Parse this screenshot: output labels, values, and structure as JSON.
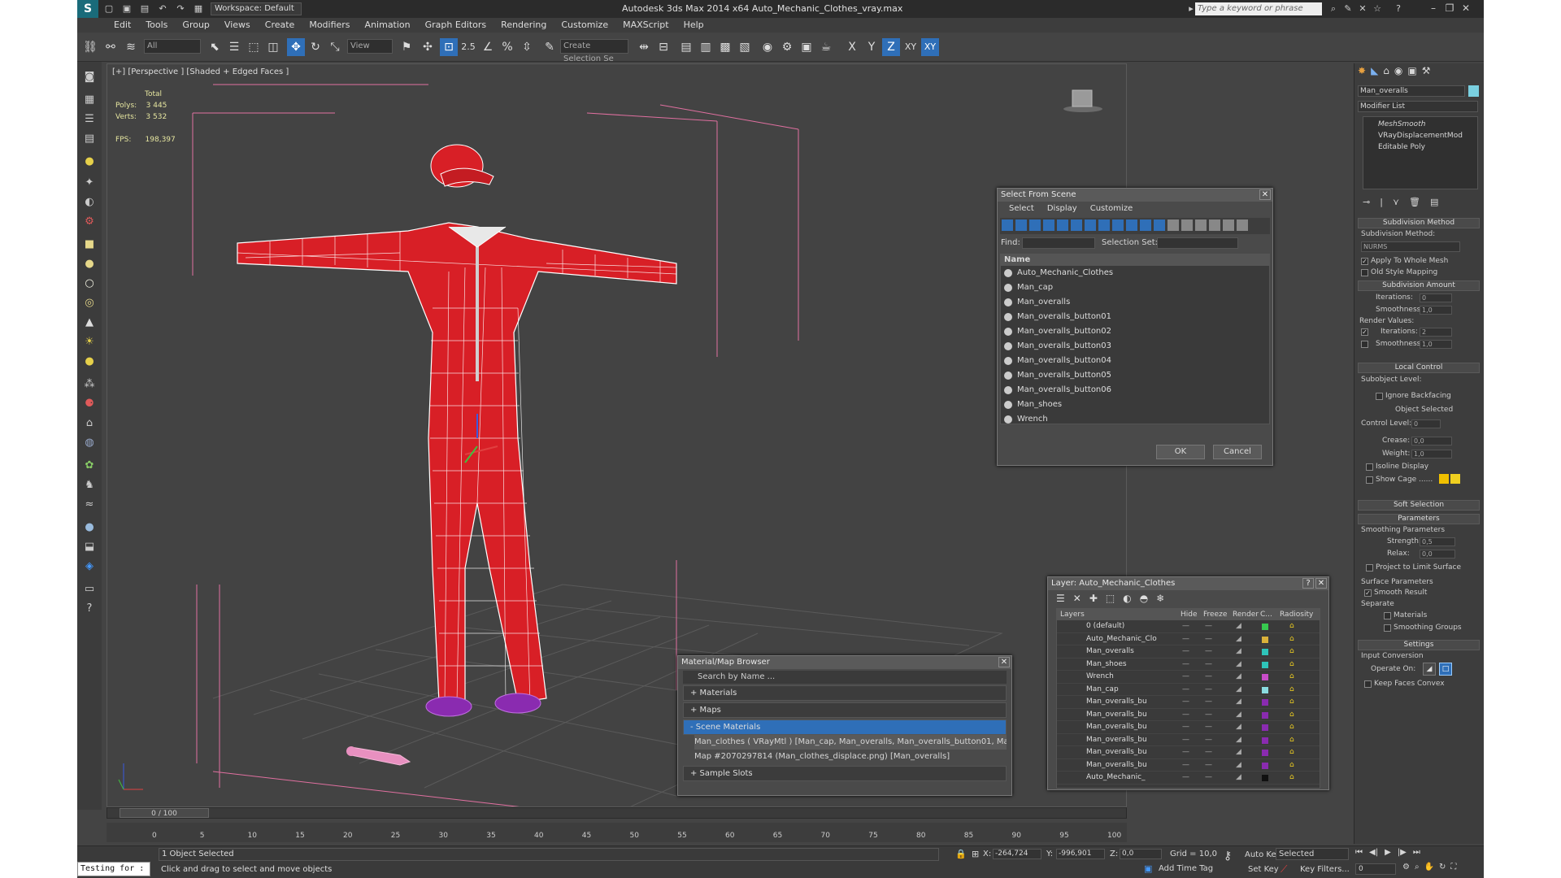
{
  "title": {
    "workspace": "Workspace: Default",
    "app_title": "Autodesk 3ds Max  2014 x64     Auto_Mechanic_Clothes_vray.max",
    "search_placeholder": "Type a keyword or phrase"
  },
  "menu": [
    "Edit",
    "Tools",
    "Group",
    "Views",
    "Create",
    "Modifiers",
    "Animation",
    "Graph Editors",
    "Rendering",
    "Customize",
    "MAXScript",
    "Help"
  ],
  "toolbar": {
    "filter": "All",
    "ref_coord": "View",
    "selection_set": "Create Selection Se",
    "snap_label": "2.5",
    "coord_labels": [
      "X",
      "Y",
      "Z",
      "XY",
      "XY"
    ]
  },
  "viewport": {
    "label": "[+] [Perspective ] [Shaded + Edged Faces ]",
    "stats_total": "Total",
    "polys_label": "Polys:",
    "polys": "3 445",
    "verts_label": "Verts:",
    "verts": "3 532",
    "fps_label": "FPS:",
    "fps": "198,397"
  },
  "select_from_scene": {
    "title": "Select From Scene",
    "menus": [
      "Select",
      "Display",
      "Customize"
    ],
    "find_label": "Find:",
    "selection_set_label": "Selection Set:",
    "column": "Name",
    "items": [
      "Auto_Mechanic_Clothes",
      "Man_cap",
      "Man_overalls",
      "Man_overalls_button01",
      "Man_overalls_button02",
      "Man_overalls_button03",
      "Man_overalls_button04",
      "Man_overalls_button05",
      "Man_overalls_button06",
      "Man_shoes",
      "Wrench"
    ],
    "ok": "OK",
    "cancel": "Cancel"
  },
  "material_browser": {
    "title": "Material/Map Browser",
    "search_placeholder": "Search by Name ...",
    "groups": [
      "+ Materials",
      "+ Maps",
      "- Scene Materials"
    ],
    "entries": [
      "Man_clothes  ( VRayMtl )  [Man_cap, Man_overalls, Man_overalls_button01, Man_o...",
      "Map #2070297814 (Man_clothes_displace.png) [Man_overalls]"
    ],
    "sample_slots": "+ Sample Slots"
  },
  "layer_manager": {
    "title": "Layer: Auto_Mechanic_Clothes",
    "columns": [
      "Layers",
      "Hide",
      "Freeze",
      "Render",
      "C...",
      "Radiosity"
    ],
    "rows": [
      {
        "name": "0 (default)",
        "color": "#37c94f"
      },
      {
        "name": "Auto_Mechanic_Clo",
        "color": "#d9b13a"
      },
      {
        "name": "Man_overalls",
        "color": "#2ec4b9"
      },
      {
        "name": "Man_shoes",
        "color": "#2ec4b9"
      },
      {
        "name": "Wrench",
        "color": "#c84cc8"
      },
      {
        "name": "Man_cap",
        "color": "#8adbe0"
      },
      {
        "name": "Man_overalls_bu",
        "color": "#8a2bb0"
      },
      {
        "name": "Man_overalls_bu",
        "color": "#8a2bb0"
      },
      {
        "name": "Man_overalls_bu",
        "color": "#8a2bb0"
      },
      {
        "name": "Man_overalls_bu",
        "color": "#8a2bb0"
      },
      {
        "name": "Man_overalls_bu",
        "color": "#8a2bb0"
      },
      {
        "name": "Man_overalls_bu",
        "color": "#8a2bb0"
      },
      {
        "name": "Auto_Mechanic_",
        "color": "#111111"
      }
    ]
  },
  "command_panel": {
    "object_name": "Man_overalls",
    "modifier_list": "Modifier List",
    "stack": [
      "MeshSmooth",
      "VRayDisplacementMod",
      "Editable Poly"
    ],
    "subdivision_method_title": "Subdivision Method",
    "subdivision_method_label": "Subdivision Method:",
    "subdivision_method_value": "NURMS",
    "apply_whole_mesh": "Apply To Whole Mesh",
    "old_style_mapping": "Old Style Mapping",
    "subdivision_amount_title": "Subdivision Amount",
    "iterations_label": "Iterations:",
    "iterations": "0",
    "smoothness_label": "Smoothness:",
    "smoothness": "1,0",
    "render_values": "Render Values:",
    "render_iterations": "2",
    "render_smoothness": "1,0",
    "local_control_title": "Local Control",
    "subobject_level": "Subobject Level:",
    "ignore_backfacing": "Ignore Backfacing",
    "object_selected": "Object Selected",
    "control_level_label": "Control Level:",
    "control_level": "0",
    "crease_label": "Crease:",
    "crease": "0,0",
    "weight_label": "Weight:",
    "weight": "1,0",
    "isoline_display": "Isoline Display",
    "show_cage": "Show Cage ......",
    "soft_selection": "Soft Selection",
    "parameters": "Parameters",
    "smoothing_parameters": "Smoothing Parameters",
    "strength_label": "Strength:",
    "strength": "0,5",
    "relax_label": "Relax:",
    "relax": "0,0",
    "project_limit": "Project to Limit Surface",
    "surface_parameters": "Surface Parameters",
    "smooth_result": "Smooth Result",
    "separate": "Separate",
    "materials": "Materials",
    "smoothing_groups": "Smoothing Groups",
    "settings": "Settings",
    "input_conversion": "Input Conversion",
    "operate_on": "Operate On:",
    "keep_faces_convex": "Keep Faces Convex"
  },
  "timeline": {
    "slider": "0 / 100",
    "ticks": [
      "0",
      "5",
      "10",
      "15",
      "20",
      "25",
      "30",
      "35",
      "40",
      "45",
      "50",
      "55",
      "60",
      "65",
      "70",
      "75",
      "80",
      "85",
      "90",
      "95",
      "100"
    ]
  },
  "status": {
    "maxscript_text": "Testing for :",
    "selection": "1 Object Selected",
    "prompt": "Click and drag to select and move objects",
    "x_label": "X:",
    "x": "-264,724",
    "y_label": "Y:",
    "y": "-996,901",
    "z_label": "Z:",
    "z": "0,0",
    "grid": "Grid = 10,0",
    "auto_key": "Auto Key",
    "selected": "Selected",
    "set_key": "Set Key",
    "key_filters": "Key Filters...",
    "add_time_tag": "Add Time Tag",
    "frame": "0"
  }
}
